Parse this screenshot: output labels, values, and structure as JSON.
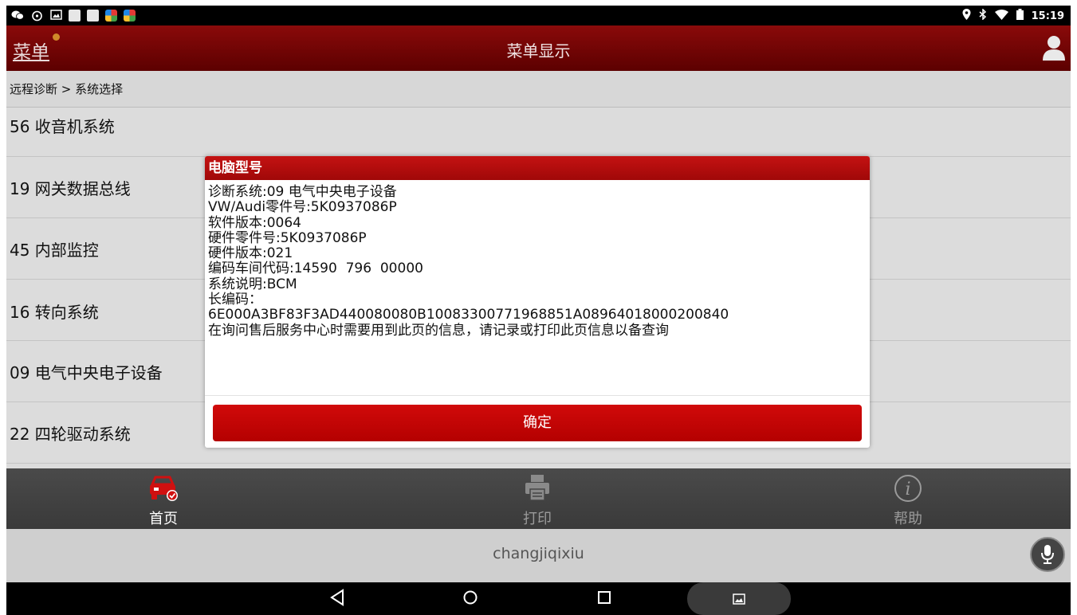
{
  "status_bar": {
    "time": "15:19",
    "left_icons": [
      "wechat-icon",
      "notification-icon",
      "image-icon",
      "square-icon",
      "square-icon",
      "app-icon",
      "app-icon"
    ],
    "right_icons": [
      "location-icon",
      "bluetooth-icon",
      "wifi-icon",
      "battery-icon"
    ]
  },
  "header": {
    "menu_label": "菜单",
    "title": "菜单显示"
  },
  "breadcrumb": "远程诊断 > 系统选择",
  "list": [
    {
      "label": "56 收音机系统"
    },
    {
      "label": "19 网关数据总线"
    },
    {
      "label": "45 内部监控"
    },
    {
      "label": "16 转向系统"
    },
    {
      "label": "09 电气中央电子设备"
    },
    {
      "label": "22 四轮驱动系统"
    }
  ],
  "dialog": {
    "title": "电脑型号",
    "lines": [
      "诊断系统:09 电气中央电子设备",
      "VW/Audi零件号:5K0937086P",
      "软件版本:0064",
      "硬件零件号:5K0937086P",
      "硬件版本:021",
      "编码车间代码:14590  796  00000",
      "系统说明:BCM",
      "长编码：",
      "6E000A3BF83F3AD440080080B10083300771968851A08964018000200840",
      "在询问售后服务中心时需要用到此页的信息，请记录或打印此页信息以备查询"
    ],
    "ok_label": "确定"
  },
  "bottom_nav": {
    "home_label": "首页",
    "print_label": "打印",
    "help_label": "帮助"
  },
  "input": {
    "text": "changjiqixiu"
  },
  "colors": {
    "header": "#7a0505",
    "dialog_header": "#b80c0c",
    "ok_button": "#c80404"
  }
}
